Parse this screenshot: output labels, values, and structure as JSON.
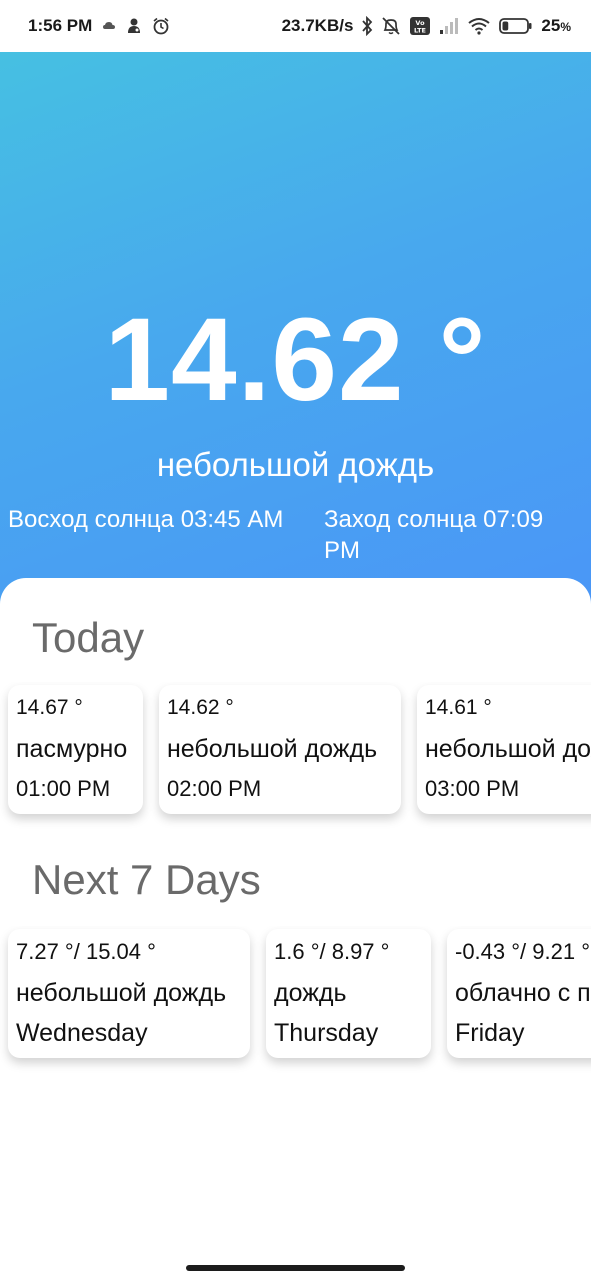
{
  "status_bar": {
    "time": "1:56 PM",
    "net_speed": "23.7KB/s",
    "battery_text": "25",
    "battery_unit": "%",
    "battery_level": 0.25,
    "volte_label": "Vo LTE",
    "left_icons": [
      "cloud-icon",
      "game-icon",
      "alarm-icon"
    ],
    "right_icons": [
      "bluetooth-icon",
      "mute-icon",
      "volte-icon",
      "signal-icon",
      "wifi-icon",
      "battery-icon"
    ]
  },
  "current": {
    "temperature": "14.62 °",
    "description": "небольшой дождь",
    "sunrise": "Восход солнца 03:45 AM",
    "sunset": "Заход солнца 07:09 PM"
  },
  "today": {
    "title": "Today",
    "items": [
      {
        "temp": "14.67 °",
        "desc": "пасмурно",
        "time": "01:00 PM"
      },
      {
        "temp": "14.62 °",
        "desc": "небольшой дождь",
        "time": "02:00 PM"
      },
      {
        "temp": "14.61 °",
        "desc": "небольшой дождь",
        "time": "03:00 PM"
      }
    ]
  },
  "week": {
    "title": "Next 7 Days",
    "items": [
      {
        "temp": "7.27 °/ 15.04 °",
        "desc": "небольшой дождь",
        "day": "Wednesday"
      },
      {
        "temp": "1.6 °/ 8.97 °",
        "desc": "дождь",
        "day": "Thursday"
      },
      {
        "temp": "-0.43 °/ 9.21 °",
        "desc": "облачно с прояснениями",
        "day": "Friday"
      }
    ]
  },
  "colors": {
    "gradient_start": "#46c0e2",
    "gradient_end": "#4a96f7",
    "section_title": "#6a6a6a",
    "text": "#111111"
  }
}
